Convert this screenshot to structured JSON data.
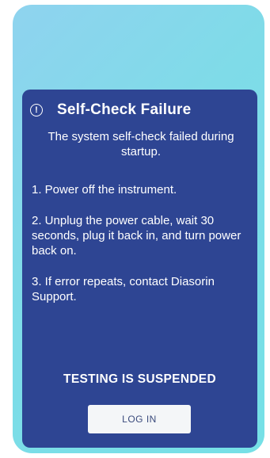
{
  "dialog": {
    "icon": "alert-circle-icon",
    "title": "Self-Check Failure",
    "summary": "The system self-check failed during startup.",
    "steps": [
      "1. Power off the instrument.",
      "2. Unplug the power cable, wait 30 seconds, plug it back in, and turn power back on.",
      "3. If error repeats, contact Diasorin Support."
    ],
    "status": "TESTING IS SUSPENDED",
    "login_label": "LOG IN"
  },
  "colors": {
    "background_gradient_start": "#8fd3ef",
    "background_gradient_end": "#75e0e6",
    "dialog": "#2e4593",
    "button": "#f4f6f8",
    "button_text": "#3a4a7c"
  }
}
